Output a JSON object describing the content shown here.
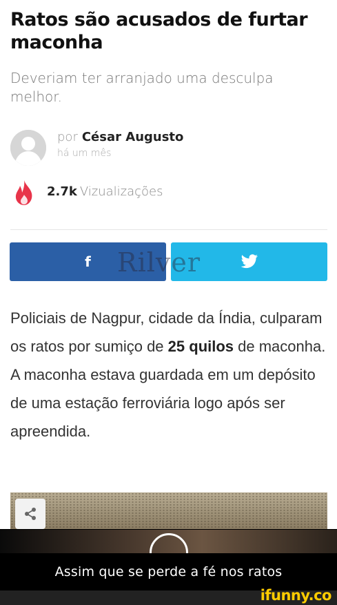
{
  "article": {
    "headline": "Ratos são acusados de furtar maconha",
    "subtitle": "Deveriam ter arranjado uma desculpa melhor.",
    "byline_prefix": "por",
    "author": "César Augusto",
    "time_ago": "há um mês",
    "view_count": "2.7k",
    "view_label": "Vizualizações",
    "body_parts": {
      "p1": "Policiais de Nagpur, cidade da Índia, culparam os ratos por sumiço de ",
      "bold": "25 quilos",
      "p2": " de maconha. A maconha estava guardada em um depósito de uma estação ferroviária logo após ser apreendida."
    }
  },
  "share": {
    "facebook_label": "f",
    "twitter_icon": "twitter-bird-icon",
    "facebook_color": "#2b5fa6",
    "twitter_color": "#22b8e8"
  },
  "watermark": "Rilver",
  "caption": "Assim que se perde a fé nos ratos",
  "brand": "ifunny.co",
  "colors": {
    "fire": "#e8344a",
    "brand_yellow": "#ffcc00"
  }
}
